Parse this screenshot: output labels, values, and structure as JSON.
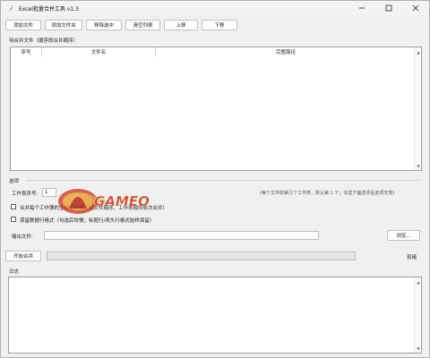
{
  "window": {
    "title": "Excel批量合并工具 v1.3"
  },
  "toolbar": {
    "add_file": "添加文件",
    "add_folder": "添加文件夹",
    "remove_selected": "移除选中",
    "clear_list": "清空列表",
    "move_up": "上移",
    "move_down": "下移"
  },
  "file_list": {
    "group_title": "待合并文件（顺序即合并顺序）",
    "columns": [
      "序号",
      "文件名",
      "完整路径"
    ]
  },
  "options": {
    "group_title": "选项",
    "sheet_index_label": "工作表序号:",
    "sheet_index_value": "1",
    "sheet_index_hint": "(每个文件取第几个工作表，默认第 1 个；勾选下面选项后此项无效)",
    "merge_all_sheets": "合并每个工作簿的全部工作表（按文件顺序、工作表顺序依次合并）",
    "keep_format": "保留数据行格式（勾选后较慢；标题行/表头行格式始终保留）"
  },
  "output": {
    "label": "输出文件:",
    "value": "",
    "browse": "浏览..."
  },
  "actions": {
    "start_merge": "开始合并",
    "status": "就绪",
    "progress": 0
  },
  "log": {
    "label": "日志"
  },
  "watermark": {
    "text": "GAMEO"
  }
}
